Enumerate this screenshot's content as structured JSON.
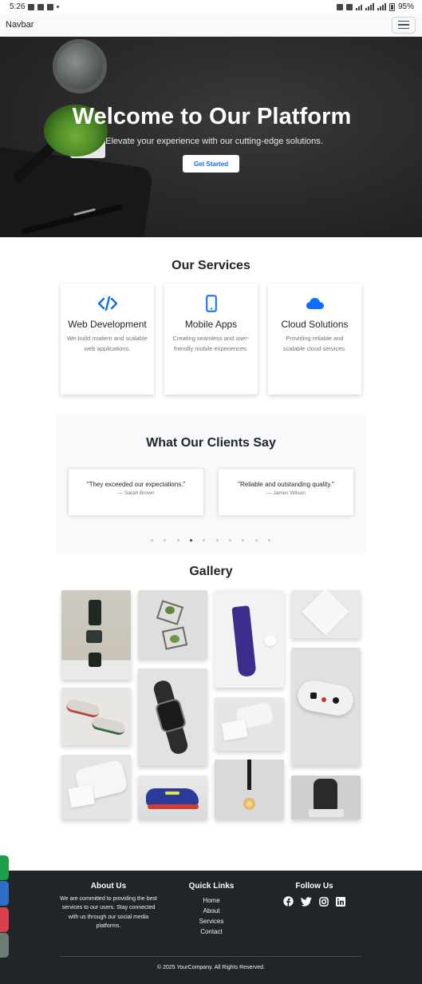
{
  "status_bar": {
    "time": "5:26",
    "battery": "95%"
  },
  "navbar": {
    "brand": "Navbar"
  },
  "hero": {
    "title": "Welcome to Our Platform",
    "subtitle": "Elevate your experience with our cutting-edge solutions.",
    "button_label": "Get Started"
  },
  "services": {
    "title": "Our Services",
    "items": [
      {
        "icon": "code-icon",
        "title": "Web Development",
        "description": "We build modern and scalable web applications."
      },
      {
        "icon": "mobile-icon",
        "title": "Mobile Apps",
        "description": "Creating seamless and user-friendly mobile experiences."
      },
      {
        "icon": "cloud-icon",
        "title": "Cloud Solutions",
        "description": "Providing reliable and scalable cloud services."
      }
    ]
  },
  "testimonials": {
    "title": "What Our Clients Say",
    "items": [
      {
        "quote": "\"They exceeded our expectations.\"",
        "author": "— Sarah Brown"
      },
      {
        "quote": "\"Reliable and outstanding quality.\"",
        "author": "— James Wilson"
      }
    ],
    "dot_count": 10,
    "active_dot": 3
  },
  "gallery": {
    "title": "Gallery"
  },
  "footer": {
    "about_title": "About Us",
    "about_text": "We are committed to providing the best services to our users. Stay connected with us through our social media platforms.",
    "links_title": "Quick Links",
    "links": [
      "Home",
      "About",
      "Services",
      "Contact"
    ],
    "follow_title": "Follow Us",
    "social": [
      "facebook-icon",
      "twitter-icon",
      "instagram-icon",
      "linkedin-icon"
    ],
    "copyright": "© 2025 YourCompany. All Rights Reserved."
  },
  "colors": {
    "accent": "#0d6efd",
    "footer_bg": "#212529",
    "section_bg": "#f8f9fa"
  }
}
